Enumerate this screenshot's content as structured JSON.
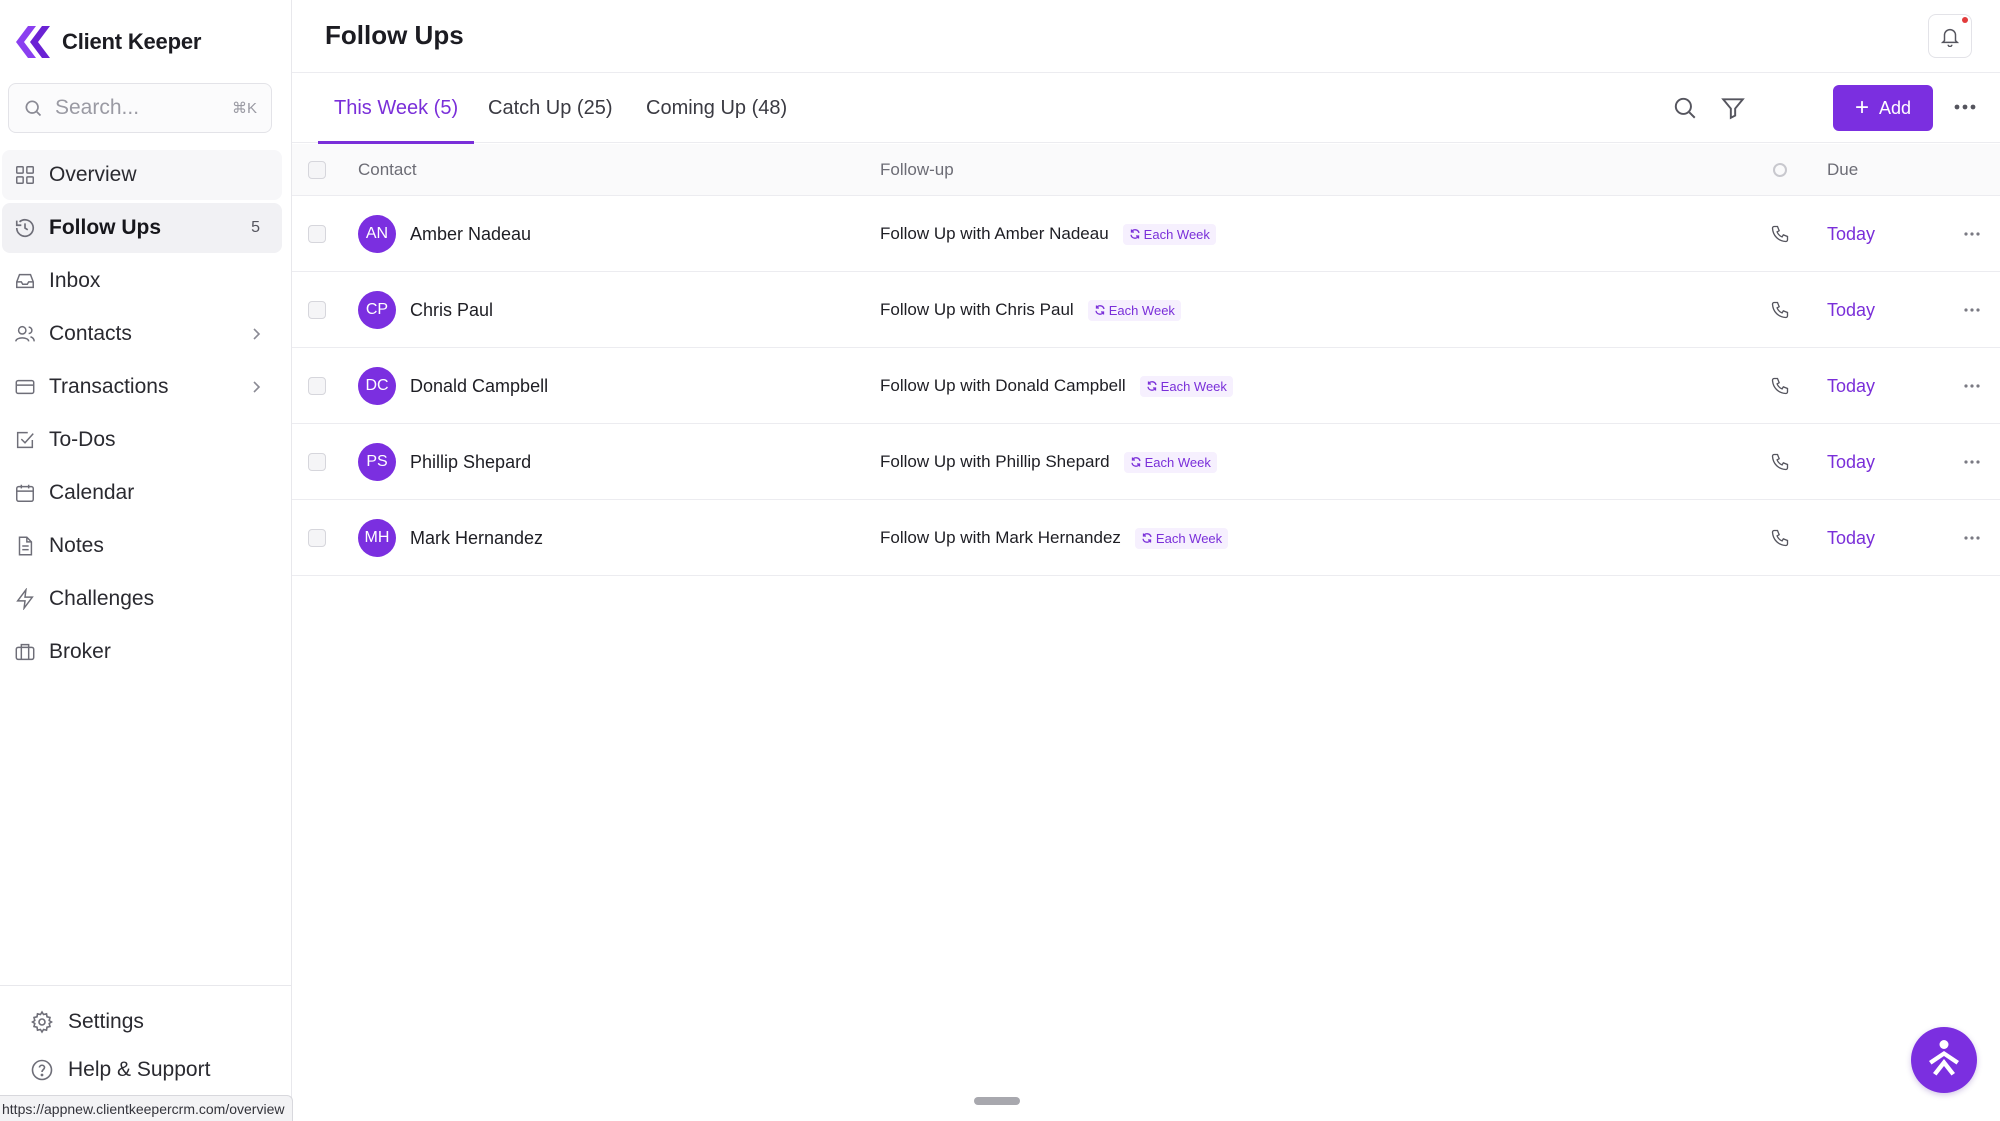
{
  "app": {
    "name": "Client Keeper",
    "accent_color": "#7b2fe0"
  },
  "search": {
    "placeholder": "Search...",
    "shortcut": "⌘K"
  },
  "sidebar": {
    "items": [
      {
        "label": "Overview",
        "icon": "grid-icon"
      },
      {
        "label": "Follow Ups",
        "icon": "history-icon",
        "count": "5"
      },
      {
        "label": "Inbox",
        "icon": "inbox-icon"
      },
      {
        "label": "Contacts",
        "icon": "users-icon"
      },
      {
        "label": "Transactions",
        "icon": "card-icon"
      },
      {
        "label": "To-Dos",
        "icon": "checkbox-icon"
      },
      {
        "label": "Calendar",
        "icon": "calendar-icon"
      },
      {
        "label": "Notes",
        "icon": "file-icon"
      },
      {
        "label": "Challenges",
        "icon": "bolt-icon"
      },
      {
        "label": "Broker",
        "icon": "briefcase-icon"
      }
    ],
    "footer": {
      "settings": "Settings",
      "help": "Help & Support"
    }
  },
  "status_url": "https://appnew.clientkeepercrm.com/overview",
  "header": {
    "title": "Follow Ups"
  },
  "tabs": [
    {
      "label": "This Week (5)"
    },
    {
      "label": "Catch Up (25)"
    },
    {
      "label": "Coming Up (48)"
    }
  ],
  "toolbar": {
    "add_label": "Add"
  },
  "table": {
    "columns": {
      "contact": "Contact",
      "followup": "Follow-up",
      "due": "Due"
    },
    "rows": [
      {
        "initials": "AN",
        "name": "Amber Nadeau",
        "followup": "Follow Up with Amber Nadeau",
        "recurrence": "Each Week",
        "due": "Today"
      },
      {
        "initials": "CP",
        "name": "Chris Paul",
        "followup": "Follow Up with Chris Paul",
        "recurrence": "Each Week",
        "due": "Today"
      },
      {
        "initials": "DC",
        "name": "Donald Campbell",
        "followup": "Follow Up with Donald Campbell",
        "recurrence": "Each Week",
        "due": "Today"
      },
      {
        "initials": "PS",
        "name": "Phillip Shepard",
        "followup": "Follow Up with Phillip Shepard",
        "recurrence": "Each Week",
        "due": "Today"
      },
      {
        "initials": "MH",
        "name": "Mark Hernandez",
        "followup": "Follow Up with Mark Hernandez",
        "recurrence": "Each Week",
        "due": "Today"
      }
    ]
  }
}
